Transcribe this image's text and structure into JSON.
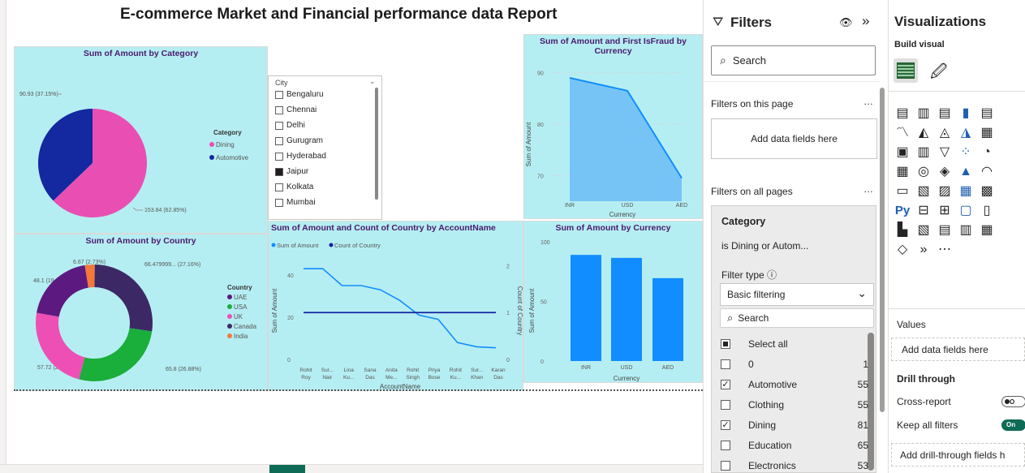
{
  "report": {
    "title": "E-commerce Market and Financial performance data Report"
  },
  "category_pie": {
    "title": "Sum of Amount by Category",
    "legend_title": "Category",
    "legend": [
      {
        "name": "Dining",
        "color": "#e94fb2"
      },
      {
        "name": "Automotive",
        "color": "#1428a0"
      }
    ],
    "labels": [
      "90.93 (37.15%)",
      "153.84 (62.85%)"
    ],
    "values": [
      90.93,
      153.84
    ]
  },
  "city_slicer": {
    "header": "City",
    "items": [
      {
        "label": "Bengaluru",
        "checked": false
      },
      {
        "label": "Chennai",
        "checked": false
      },
      {
        "label": "Delhi",
        "checked": false
      },
      {
        "label": "Gurugram",
        "checked": false
      },
      {
        "label": "Hyderabad",
        "checked": false
      },
      {
        "label": "Jaipur",
        "checked": true
      },
      {
        "label": "Kolkata",
        "checked": false
      },
      {
        "label": "Mumbai",
        "checked": false
      }
    ]
  },
  "fraud_area": {
    "title": "Sum of Amount and First IsFraud by Currency",
    "xlabel": "Currency",
    "ylabel": "Sum of Amount",
    "categories": [
      "INR",
      "USD",
      "AED"
    ],
    "values": [
      89,
      86.5,
      69.5
    ],
    "yticks": [
      "70",
      "80",
      "90"
    ]
  },
  "country_donut": {
    "title": "Sum of Amount by Country",
    "legend_title": "Country",
    "legend": [
      {
        "name": "UAE",
        "color": "#5c1a80"
      },
      {
        "name": "USA",
        "color": "#1aae3a"
      },
      {
        "name": "UK",
        "color": "#ed4fb5"
      },
      {
        "name": "Canada",
        "color": "#3d2866"
      },
      {
        "name": "India",
        "color": "#f2793a"
      }
    ],
    "labels": [
      "6.67 (2.73%)",
      "66.479999... (27.16%)",
      "48.1 (19.65%)",
      "57.72 (23.58%)",
      "65.8 (26.88%)"
    ]
  },
  "account_line": {
    "title": "Sum of Amount and Count of Country by AccountName",
    "legend": [
      {
        "name": "Sum of Amount",
        "color": "#118dff"
      },
      {
        "name": "Count of Country",
        "color": "#12239e"
      }
    ],
    "xlabel": "AccountName",
    "ylabel_left": "Sum of Amount",
    "ylabel_right": "Count of Country",
    "yticks_left": [
      "0",
      "20",
      "40"
    ],
    "yticks_right": [
      "0",
      "1",
      "2"
    ],
    "categories": [
      [
        "Rohit",
        "Roy"
      ],
      [
        "Sur...",
        "Nair"
      ],
      [
        "Lina",
        "Ku..."
      ],
      [
        "Sana",
        "Das"
      ],
      [
        "Anita",
        "Me..."
      ],
      [
        "Rohit",
        "Singh"
      ],
      [
        "Priya",
        "Bose"
      ],
      [
        "Rohit",
        "Ku..."
      ],
      [
        "Sur...",
        "Khan"
      ],
      [
        "Karan",
        "Das"
      ]
    ],
    "amount": [
      43,
      43,
      35,
      35,
      33,
      28,
      21,
      19,
      8,
      6,
      5.5
    ],
    "count": [
      1,
      1,
      1,
      1,
      1,
      1,
      1,
      1,
      1,
      1
    ]
  },
  "currency_bar": {
    "title": "Sum of Amount by Currency",
    "xlabel": "Currency",
    "ylabel": "Sum of Amount",
    "categories": [
      "INR",
      "USD",
      "AED"
    ],
    "values": [
      89,
      86.5,
      69.5
    ],
    "yticks": [
      "0",
      "50",
      "100"
    ]
  },
  "filters": {
    "header": "Filters",
    "search_placeholder": "Search",
    "on_this_page": "Filters on this page",
    "add_fields": "Add data fields here",
    "on_all_pages": "Filters on all pages",
    "card": {
      "field": "Category",
      "summary": "is Dining or Autom...",
      "filter_type_label": "Filter type",
      "filter_type_value": "Basic filtering",
      "search_placeholder": "Search",
      "select_all": "Select all",
      "items": [
        {
          "label": "0",
          "count": "1",
          "checked": false
        },
        {
          "label": "Automotive",
          "count": "55",
          "checked": true
        },
        {
          "label": "Clothing",
          "count": "55",
          "checked": false
        },
        {
          "label": "Dining",
          "count": "81",
          "checked": true
        },
        {
          "label": "Education",
          "count": "65",
          "checked": false
        },
        {
          "label": "Electronics",
          "count": "53",
          "checked": false
        }
      ]
    }
  },
  "visualizations": {
    "header": "Visualizations",
    "build_visual": "Build visual",
    "values_label": "Values",
    "values_drop": "Add data fields here",
    "drill_through": "Drill through",
    "cross_report": "Cross-report",
    "cross_report_toggle": "O",
    "keep_all_filters": "Keep all filters",
    "keep_all_toggle": "On",
    "drill_drop": "Add drill-through fields h"
  }
}
